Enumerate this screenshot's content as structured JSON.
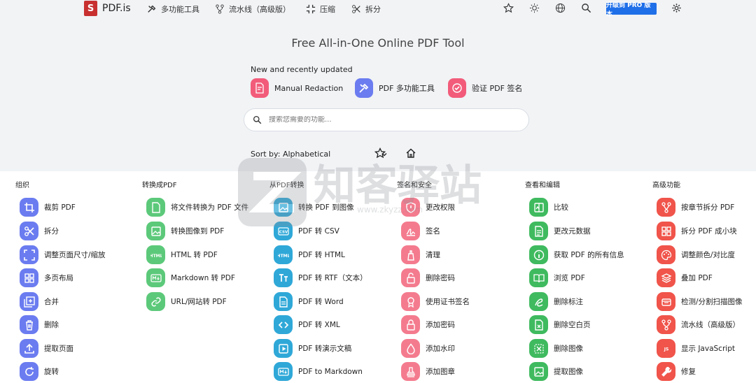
{
  "header": {
    "logo_mark": "S",
    "brand": "PDF.is",
    "nav": [
      {
        "label": "多功能工具",
        "icon": "tools-icon"
      },
      {
        "label": "流水线（高级版）",
        "icon": "pipeline-icon"
      },
      {
        "label": "压缩",
        "icon": "compress-icon"
      },
      {
        "label": "拆分",
        "icon": "scissors-icon"
      }
    ],
    "pro_button": "升级到 PRO 版本"
  },
  "hero": {
    "title": "Free All-in-One Online PDF Tool",
    "recent_label": "New and recently updated",
    "recent": [
      {
        "label": "Manual Redaction",
        "color": "#f25c7a"
      },
      {
        "label": "PDF 多功能工具",
        "color": "#6b7cf0"
      },
      {
        "label": "验证 PDF 签名",
        "color": "#f25c7a"
      }
    ],
    "search_placeholder": "搜索您需要的功能...",
    "sort_label": "Sort by: Alphabetical"
  },
  "watermark": {
    "text": "知客驿站",
    "url": "www.zkyzz.com"
  },
  "columns": [
    {
      "heading": "组织",
      "color": "#6b7cf0",
      "tools": [
        {
          "label": "裁剪 PDF",
          "icon": "crop-icon"
        },
        {
          "label": "拆分",
          "icon": "scissors-icon"
        },
        {
          "label": "调整页面尺寸/缩放",
          "icon": "resize-icon"
        },
        {
          "label": "多页布局",
          "icon": "grid-icon"
        },
        {
          "label": "合并",
          "icon": "merge-icon"
        },
        {
          "label": "删除",
          "icon": "trash-icon"
        },
        {
          "label": "提取页面",
          "icon": "upload-icon"
        },
        {
          "label": "旋转",
          "icon": "rotate-icon"
        }
      ]
    },
    {
      "heading": "转换成PDF",
      "color": "#5cc97a",
      "tools": [
        {
          "label": "将文件转换为 PDF 文件",
          "icon": "file-icon"
        },
        {
          "label": "转换图像到 PDF",
          "icon": "image-icon"
        },
        {
          "label": "HTML 转 PDF",
          "icon": "html-icon"
        },
        {
          "label": "Markdown 转 PDF",
          "icon": "markdown-icon"
        },
        {
          "label": "URL/网站转 PDF",
          "icon": "link-icon"
        }
      ]
    },
    {
      "heading": "从PDF转换",
      "color": "#2fa8d8",
      "tools": [
        {
          "label": "转换 PDF 到图像",
          "icon": "image-icon"
        },
        {
          "label": "PDF 转 CSV",
          "icon": "csv-icon"
        },
        {
          "label": "PDF 转 HTML",
          "icon": "html-icon"
        },
        {
          "label": "PDF 转 RTF（文本）",
          "icon": "text-icon"
        },
        {
          "label": "PDF 转 Word",
          "icon": "doc-icon"
        },
        {
          "label": "PDF 转 XML",
          "icon": "code-icon"
        },
        {
          "label": "PDF 转演示文稿",
          "icon": "slides-icon"
        },
        {
          "label": "PDF to Markdown",
          "icon": "markdown-icon"
        }
      ]
    },
    {
      "heading": "签名和安全",
      "color": "#f47b8e",
      "tools": [
        {
          "label": "更改权限",
          "icon": "shield-icon"
        },
        {
          "label": "签名",
          "icon": "signature-icon"
        },
        {
          "label": "清理",
          "icon": "clean-icon"
        },
        {
          "label": "删除密码",
          "icon": "unlock-icon"
        },
        {
          "label": "使用证书签名",
          "icon": "certificate-icon"
        },
        {
          "label": "添加密码",
          "icon": "lock-icon"
        },
        {
          "label": "添加水印",
          "icon": "droplet-icon"
        },
        {
          "label": "添加图章",
          "icon": "stamp-icon"
        }
      ]
    },
    {
      "heading": "查看和编辑",
      "color": "#3fba5f",
      "tools": [
        {
          "label": "比较",
          "icon": "compare-icon"
        },
        {
          "label": "更改元数据",
          "icon": "metadata-icon"
        },
        {
          "label": "获取 PDF 的所有信息",
          "icon": "info-icon"
        },
        {
          "label": "浏览 PDF",
          "icon": "book-icon"
        },
        {
          "label": "删除标注",
          "icon": "annotation-icon"
        },
        {
          "label": "删除空白页",
          "icon": "blank-page-icon"
        },
        {
          "label": "删除图像",
          "icon": "remove-image-icon"
        },
        {
          "label": "提取图像",
          "icon": "extract-image-icon"
        }
      ]
    },
    {
      "heading": "高级功能",
      "color": "#f0544a",
      "tools": [
        {
          "label": "按章节拆分 PDF",
          "icon": "split-chapter-icon"
        },
        {
          "label": "拆分 PDF 成小块",
          "icon": "grid-icon"
        },
        {
          "label": "调整颜色/对比度",
          "icon": "palette-icon"
        },
        {
          "label": "叠加 PDF",
          "icon": "layers-icon"
        },
        {
          "label": "检测/分割扫描图像",
          "icon": "scan-icon"
        },
        {
          "label": "流水线（高级版）",
          "icon": "pipeline-icon"
        },
        {
          "label": "显示 JavaScript",
          "icon": "js-icon"
        },
        {
          "label": "修复",
          "icon": "wrench-icon"
        }
      ]
    }
  ]
}
